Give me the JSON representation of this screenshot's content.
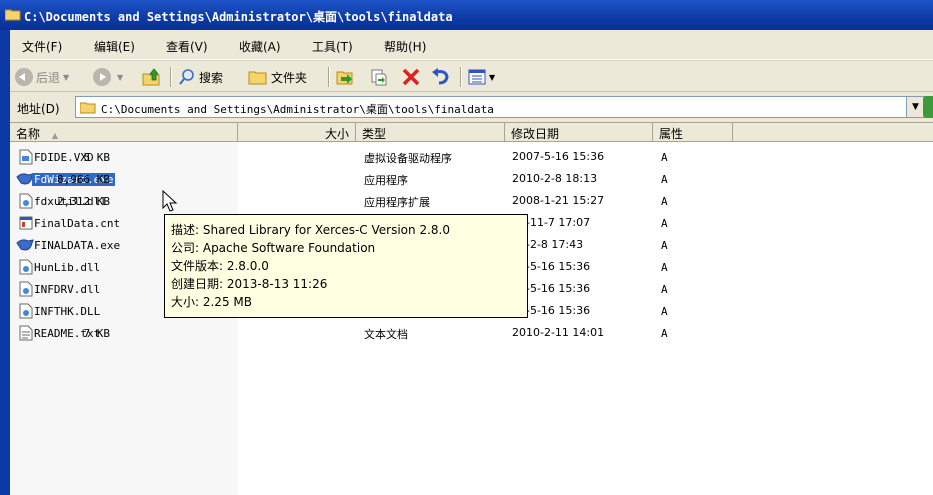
{
  "window": {
    "title": "C:\\Documents and Settings\\Administrator\\桌面\\tools\\finaldata"
  },
  "menu": [
    {
      "label": "文件(F)"
    },
    {
      "label": "编辑(E)"
    },
    {
      "label": "查看(V)"
    },
    {
      "label": "收藏(A)"
    },
    {
      "label": "工具(T)"
    },
    {
      "label": "帮助(H)"
    }
  ],
  "toolbar": {
    "back_label": "后退",
    "search_label": "搜索",
    "folders_label": "文件夹"
  },
  "address": {
    "label": "地址(D)",
    "value": "C:\\Documents and Settings\\Administrator\\桌面\\tools\\finaldata"
  },
  "columns": {
    "name": "名称",
    "size": "大小",
    "type": "类型",
    "modified": "修改日期",
    "attributes": "属性"
  },
  "files": [
    {
      "name": "FDIDE.VXD",
      "size": "5 KB",
      "type": "虚拟设备驱动程序",
      "modified": "2007-5-16 15:36",
      "attr": "A",
      "icon": "system-file-icon"
    },
    {
      "name": "FdWizard.exe",
      "size": "8,966 KB",
      "type": "应用程序",
      "modified": "2010-2-8 18:13",
      "attr": "A",
      "icon": "application-icon",
      "selected": true
    },
    {
      "name": "fdxutil.dll",
      "size": "2,312 KB",
      "type": "应用程序扩展",
      "modified": "2008-1-21 15:27",
      "attr": "A",
      "icon": "dll-file-icon"
    },
    {
      "name": "FinalData.cnt",
      "size": "",
      "type": "",
      "modified": "08-11-7 17:07",
      "attr": "A",
      "icon": "help-contents-icon"
    },
    {
      "name": "FINALDATA.exe",
      "size": "",
      "type": "",
      "modified": "10-2-8 17:43",
      "attr": "A",
      "icon": "application-icon"
    },
    {
      "name": "HunLib.dll",
      "size": "",
      "type": "",
      "modified": "07-5-16 15:36",
      "attr": "A",
      "icon": "dll-file-icon"
    },
    {
      "name": "INFDRV.dll",
      "size": "",
      "type": "",
      "modified": "07-5-16 15:36",
      "attr": "A",
      "icon": "dll-file-icon"
    },
    {
      "name": "INFTHK.DLL",
      "size": "",
      "type": "",
      "modified": "07-5-16 15:36",
      "attr": "A",
      "icon": "dll-file-icon"
    },
    {
      "name": "README.txt",
      "size": "7 KB",
      "type": "文本文档",
      "modified": "2010-2-11 14:01",
      "attr": "A",
      "icon": "text-file-icon"
    }
  ],
  "tooltip": {
    "description": "描述: Shared Library for Xerces-C Version 2.8.0",
    "company": "公司: Apache Software Foundation",
    "version": "文件版本: 2.8.0.0",
    "created": "创建日期: 2013-8-13 11:26",
    "size": "大小: 2.25 MB"
  },
  "colors": {
    "title_bar": "#0d3aa8",
    "selection": "#316ac5",
    "tooltip_bg": "#ffffe1",
    "chrome": "#ece9d8"
  }
}
